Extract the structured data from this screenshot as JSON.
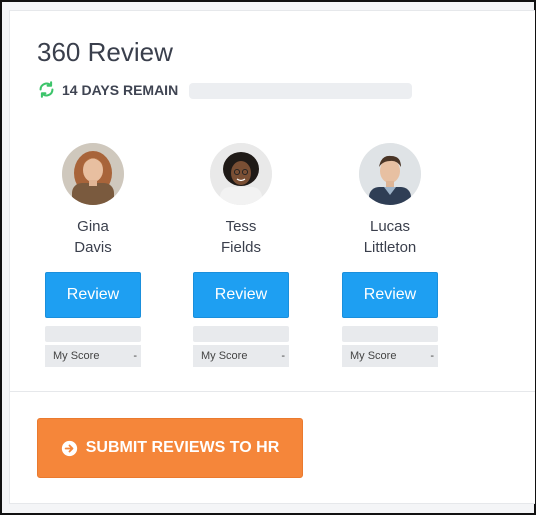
{
  "page": {
    "title": "360 Review",
    "days_remaining": "14 DAYS REMAIN"
  },
  "icons": {
    "refresh": "refresh-icon",
    "submit": "arrow-right-circle-icon"
  },
  "colors": {
    "review_button": "#1e9ff2",
    "submit_button": "#f5863a",
    "refresh_icon": "#3cc46a"
  },
  "people": [
    {
      "first": "Gina",
      "last": "Davis",
      "review_label": "Review",
      "score_label": "My Score",
      "score_value": "-"
    },
    {
      "first": "Tess",
      "last": "Fields",
      "review_label": "Review",
      "score_label": "My Score",
      "score_value": "-"
    },
    {
      "first": "Lucas",
      "last": "Littleton",
      "review_label": "Review",
      "score_label": "My Score",
      "score_value": "-"
    }
  ],
  "submit": {
    "label": "SUBMIT REVIEWS TO HR"
  }
}
